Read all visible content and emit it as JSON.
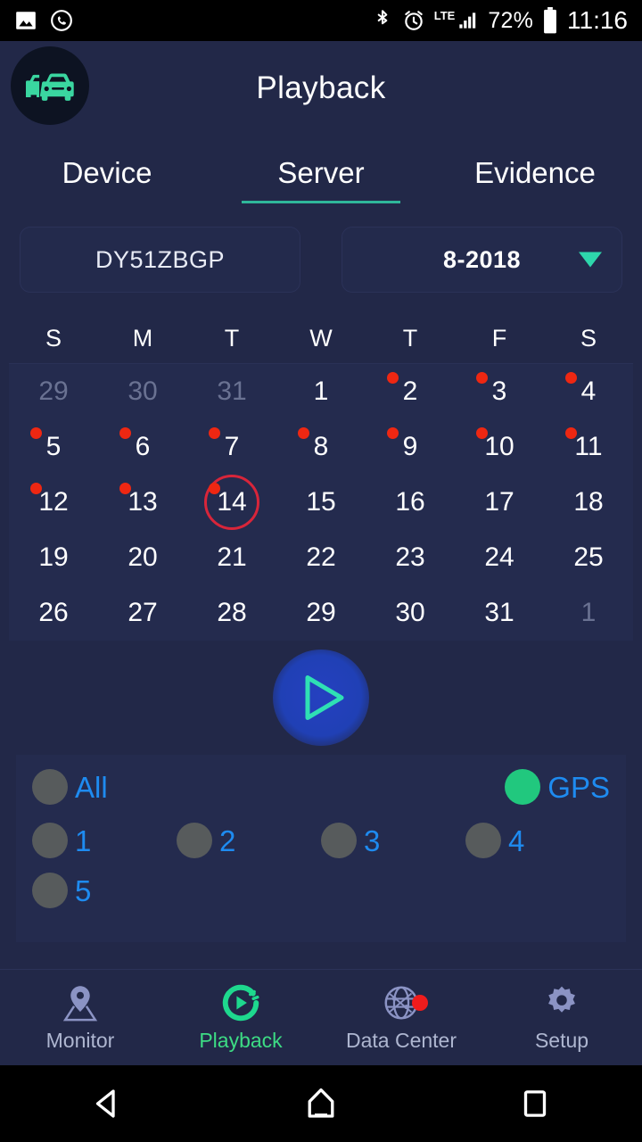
{
  "statusbar": {
    "icons_left": [
      "gallery-icon",
      "whatsapp-icon"
    ],
    "bluetooth": "bluetooth-icon",
    "alarm": "alarm-icon",
    "network_label": "LTE",
    "battery_percent": "72%",
    "time": "11:16"
  },
  "header": {
    "logo": "two-cars-logo",
    "title": "Playback"
  },
  "tabs": [
    {
      "label": "Device",
      "active": false
    },
    {
      "label": "Server",
      "active": true
    },
    {
      "label": "Evidence",
      "active": false
    }
  ],
  "selectors": {
    "vehicle": "DY51ZBGP",
    "month": "8-2018",
    "caret": "chevron-down-icon"
  },
  "calendar": {
    "weekdays": [
      "S",
      "M",
      "T",
      "W",
      "T",
      "F",
      "S"
    ],
    "days": [
      {
        "n": "29",
        "muted": true,
        "dot": false,
        "selected": false
      },
      {
        "n": "30",
        "muted": true,
        "dot": false,
        "selected": false
      },
      {
        "n": "31",
        "muted": true,
        "dot": false,
        "selected": false
      },
      {
        "n": "1",
        "muted": false,
        "dot": false,
        "selected": false
      },
      {
        "n": "2",
        "muted": false,
        "dot": true,
        "selected": false
      },
      {
        "n": "3",
        "muted": false,
        "dot": true,
        "selected": false
      },
      {
        "n": "4",
        "muted": false,
        "dot": true,
        "selected": false
      },
      {
        "n": "5",
        "muted": false,
        "dot": true,
        "selected": false
      },
      {
        "n": "6",
        "muted": false,
        "dot": true,
        "selected": false
      },
      {
        "n": "7",
        "muted": false,
        "dot": true,
        "selected": false
      },
      {
        "n": "8",
        "muted": false,
        "dot": true,
        "selected": false
      },
      {
        "n": "9",
        "muted": false,
        "dot": true,
        "selected": false
      },
      {
        "n": "10",
        "muted": false,
        "dot": true,
        "selected": false
      },
      {
        "n": "11",
        "muted": false,
        "dot": true,
        "selected": false
      },
      {
        "n": "12",
        "muted": false,
        "dot": true,
        "selected": false
      },
      {
        "n": "13",
        "muted": false,
        "dot": true,
        "selected": false
      },
      {
        "n": "14",
        "muted": false,
        "dot": true,
        "selected": true
      },
      {
        "n": "15",
        "muted": false,
        "dot": false,
        "selected": false
      },
      {
        "n": "16",
        "muted": false,
        "dot": false,
        "selected": false
      },
      {
        "n": "17",
        "muted": false,
        "dot": false,
        "selected": false
      },
      {
        "n": "18",
        "muted": false,
        "dot": false,
        "selected": false
      },
      {
        "n": "19",
        "muted": false,
        "dot": false,
        "selected": false
      },
      {
        "n": "20",
        "muted": false,
        "dot": false,
        "selected": false
      },
      {
        "n": "21",
        "muted": false,
        "dot": false,
        "selected": false
      },
      {
        "n": "22",
        "muted": false,
        "dot": false,
        "selected": false
      },
      {
        "n": "23",
        "muted": false,
        "dot": false,
        "selected": false
      },
      {
        "n": "24",
        "muted": false,
        "dot": false,
        "selected": false
      },
      {
        "n": "25",
        "muted": false,
        "dot": false,
        "selected": false
      },
      {
        "n": "26",
        "muted": false,
        "dot": false,
        "selected": false
      },
      {
        "n": "27",
        "muted": false,
        "dot": false,
        "selected": false
      },
      {
        "n": "28",
        "muted": false,
        "dot": false,
        "selected": false
      },
      {
        "n": "29",
        "muted": false,
        "dot": false,
        "selected": false
      },
      {
        "n": "30",
        "muted": false,
        "dot": false,
        "selected": false
      },
      {
        "n": "31",
        "muted": false,
        "dot": false,
        "selected": false
      },
      {
        "n": "1",
        "muted": true,
        "dot": false,
        "selected": false
      }
    ]
  },
  "play_button": {
    "icon": "play-icon"
  },
  "channels": {
    "row1": [
      {
        "label": "All",
        "on": false
      },
      {
        "label": "GPS",
        "on": true
      }
    ],
    "row2": [
      {
        "label": "1",
        "on": false
      },
      {
        "label": "2",
        "on": false
      },
      {
        "label": "3",
        "on": false
      },
      {
        "label": "4",
        "on": false
      }
    ],
    "row3": [
      {
        "label": "5",
        "on": false
      }
    ]
  },
  "bottom_nav": [
    {
      "label": "Monitor",
      "icon": "map-pin-icon",
      "active": false,
      "badge": false
    },
    {
      "label": "Playback",
      "icon": "play-circle-icon",
      "active": true,
      "badge": false
    },
    {
      "label": "Data Center",
      "icon": "globe-network-icon",
      "active": false,
      "badge": true
    },
    {
      "label": "Setup",
      "icon": "gear-icon",
      "active": false,
      "badge": false
    }
  ],
  "android_nav": [
    {
      "icon": "back-triangle-icon"
    },
    {
      "icon": "home-icon"
    },
    {
      "icon": "recents-square-icon"
    }
  ],
  "colors": {
    "background": "#222848",
    "panel": "#242b4e",
    "accent_teal": "#2ed6ac",
    "accent_green": "#21c87e",
    "accent_blue": "#1e8bf0",
    "dot_red": "#ee2712",
    "select_ring": "#d8253a",
    "nav_active": "#3ddc84"
  }
}
